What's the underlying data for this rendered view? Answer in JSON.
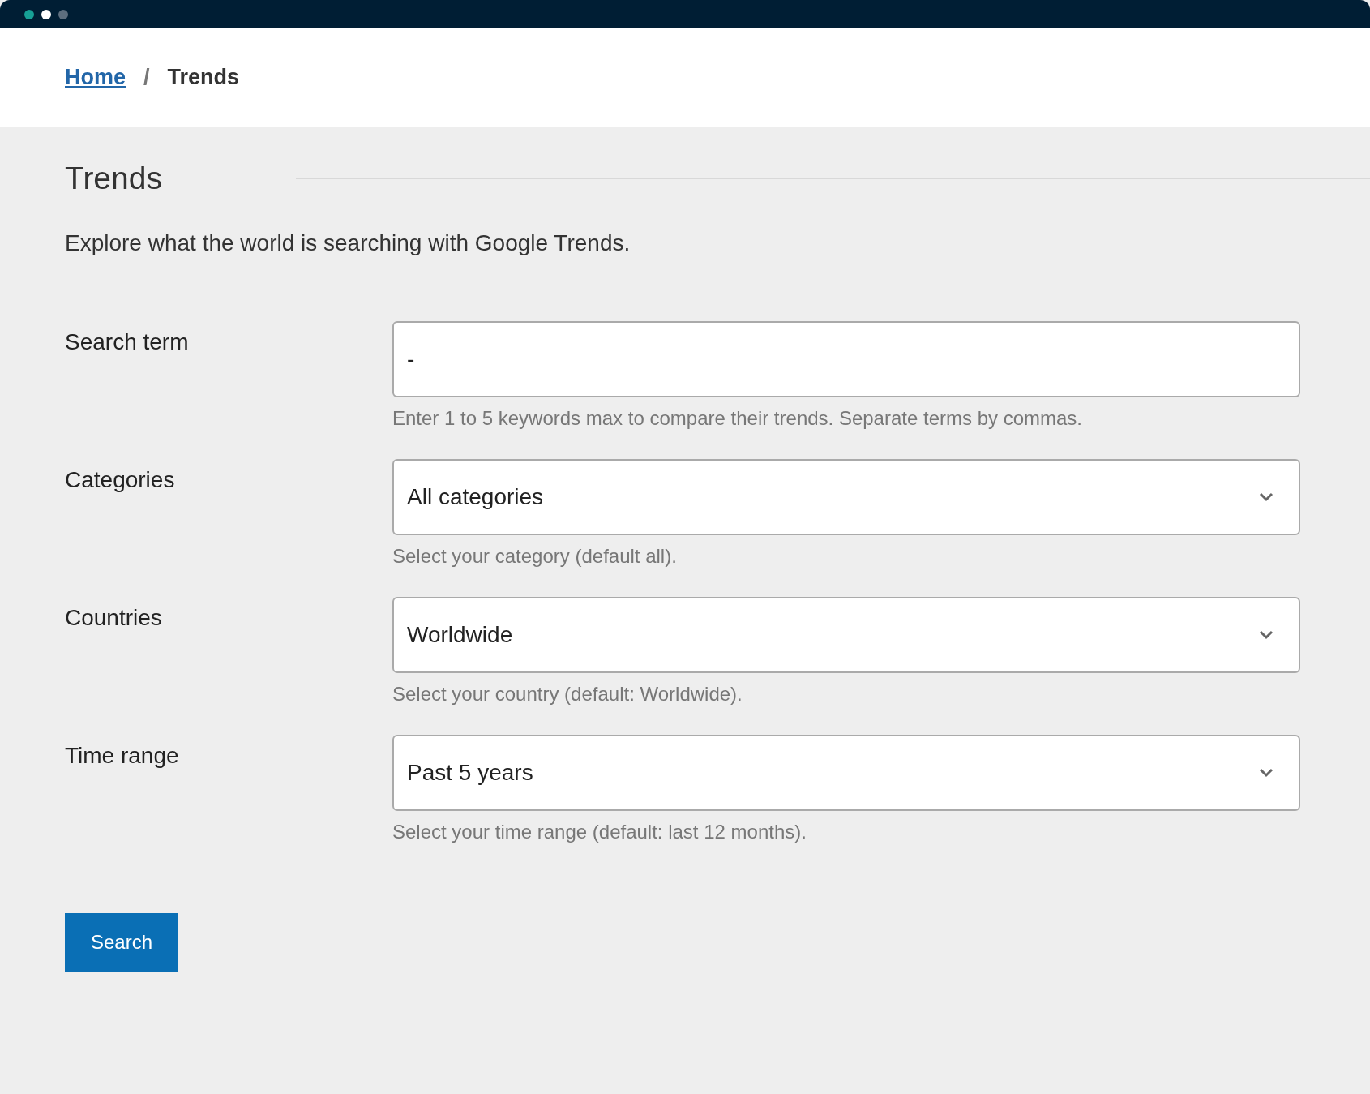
{
  "breadcrumb": [
    {
      "label": "Home",
      "kind": "link"
    },
    {
      "label": "Trends",
      "kind": "current"
    }
  ],
  "breadcrumb_separator": "/",
  "page": {
    "title": "Trends",
    "description": "Explore what the world is searching with Google Trends."
  },
  "fields": [
    {
      "kind": "text",
      "label": "Search term",
      "value": "-",
      "help": "Enter 1 to 5 keywords max to compare their trends. Separate terms by commas."
    },
    {
      "kind": "select",
      "label": "Categories",
      "value": "All categories",
      "help": "Select your category (default all)."
    },
    {
      "kind": "select",
      "label": "Countries",
      "value": "Worldwide",
      "help": "Select your country (default: Worldwide)."
    },
    {
      "kind": "select",
      "label": "Time range",
      "value": "Past 5 years",
      "help": "Select your time range (default: last 12 months)."
    }
  ],
  "submit_button": "Search"
}
